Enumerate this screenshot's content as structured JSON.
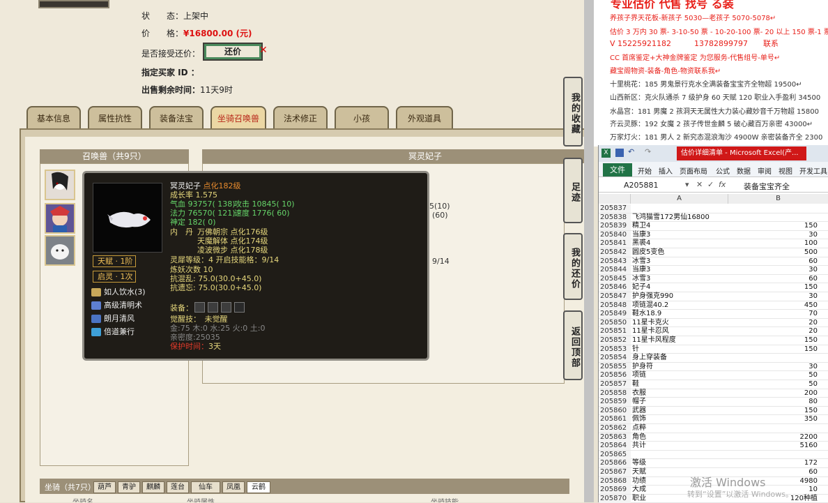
{
  "game": {
    "status_label": "状　　态：",
    "status_value": "上架中",
    "price_label": "价　　格：",
    "price_value": "¥16800.00 (元)",
    "accept_haggle_label": "是否接受还价：",
    "haggle_button": "还价",
    "buyer_id_label": "指定买家 ID ：",
    "remaining_label": "出售剩余时间：",
    "remaining_value": "11天9时",
    "tabs": [
      "基本信息",
      "属性抗性",
      "装备法宝",
      "坐骑召唤兽",
      "法术修正",
      "小孩",
      "外观道具"
    ],
    "active_tab": "坐骑召唤兽",
    "pet_list_title": "召唤兽（共9只）",
    "selected_pet_title": "冥灵妃子",
    "behind_text_1": "5(10)",
    "behind_text_2": "(60)",
    "behind_text_3": "9/14",
    "side_buttons": [
      "我的收藏",
      "足迹",
      "我的还价",
      "返回顶部"
    ],
    "mount_bar_label": "坐骑（共7只）",
    "mount_tabs": [
      "葫芦",
      "青驴",
      "麒麟",
      "莲台",
      "仙车",
      "凤凰",
      "云鹤"
    ],
    "mount_col_1": "坐骑名",
    "mount_col_2": "坐骑属性",
    "mount_col_3": "坐骑技能"
  },
  "tooltip": {
    "name": "冥灵妃子",
    "level": "点化182级",
    "growth": "成长率 1.575",
    "hp": "气血 93757( 138)",
    "attack": "攻击 10845( 10)",
    "mana": "法力 76570( 121)",
    "speed": "速度 1776( 60)",
    "spirit": "神定 182( 0)",
    "dan_label": "内　丹",
    "dan_1": "万佛朝宗 点化176级",
    "dan_2": "天魔解体 点化174级",
    "dan_3": "凌波微步 点化178级",
    "soul_level": "灵犀等级：4 开启技能格：9/14",
    "refine": "炼妖次数 10",
    "resist_chaos": "抗混乱: 75.0(30.0+45.0)",
    "resist_forget": "抗遗忘: 75.0(30.0+45.0)",
    "talent": "天赋 · 1阶",
    "enlighten": "启灵 · 1次",
    "skills": [
      "如人饮水(3)",
      "高级清明术",
      "朗月清风",
      "倍道兼行"
    ],
    "equip_label": "装备：",
    "awaken": "觉醒技：　未觉醒",
    "elements": "金:75 木:0 水:25 火:0 土:0",
    "intimacy": "亲密度:25035",
    "protect_label": "保护时间：",
    "protect_value": "3天"
  },
  "doc": {
    "headline": "专业估价 代售 找号 る装",
    "lines": [
      "养孩子界天花板-新孩子 5030—老孩子 5070-5078↵",
      "估价 3 万内 30 票- 3-10-50 票 - 10-20-100 票- 20 以上 150 票-1 票 1",
      "V 15225921182　　　13782899797　　联系",
      "CC 首席鉴定+大神金牌鉴定 为您服务-代售组号-单号↵",
      "藏宝阁物资-装备-角色-物资联系我↵",
      "十里桃花：185 男鬼景行克水全满装备宝宝齐全物超 19500↵",
      "山西新区：克火队通杀 7 级护身 60 天赋 120 职业入手盈利 34500",
      "水晶宫：181 男魔 2 孩洞天无属性大力装心藏妙音千万物超 15800",
      "齐云灵豚：192 女魔 2 孩子传世金麟 5 破心藏百万亲密 43000↵",
      "万家灯火：181 男人 2 新究态混浪淘沙 4900W 亲密装备齐全 2300"
    ]
  },
  "excel": {
    "title": "估价详细清单 - Microsoft Excel(产...",
    "menu": [
      "开始",
      "插入",
      "页面布局",
      "公式",
      "数据",
      "审阅",
      "视图",
      "开发工具"
    ],
    "file_tab": "文件",
    "cell_ref": "A205881",
    "formula": "装备宝宝齐全",
    "col_a": "A",
    "col_b": "B",
    "rows": [
      {
        "n": "205837",
        "a": "",
        "b": ""
      },
      {
        "n": "205838",
        "a": "飞鸿猫雪172男仙16800",
        "b": ""
      },
      {
        "n": "205839",
        "a": "精卫4",
        "b": "150"
      },
      {
        "n": "205840",
        "a": "当康3",
        "b": "30"
      },
      {
        "n": "205841",
        "a": "黑裘4",
        "b": "100"
      },
      {
        "n": "205842",
        "a": "圆皮5变色",
        "b": "500"
      },
      {
        "n": "205843",
        "a": "冰雪3",
        "b": "60"
      },
      {
        "n": "205844",
        "a": "当康3",
        "b": "30"
      },
      {
        "n": "205845",
        "a": "冰雪3",
        "b": "60"
      },
      {
        "n": "205846",
        "a": "妃子4",
        "b": "150"
      },
      {
        "n": "205847",
        "a": "护身强克990",
        "b": "30"
      },
      {
        "n": "205848",
        "a": "项链混40.2",
        "b": "450"
      },
      {
        "n": "205849",
        "a": "鞋水18.9",
        "b": "70"
      },
      {
        "n": "205850",
        "a": "11星卡克火",
        "b": "20"
      },
      {
        "n": "205851",
        "a": "11星卡忍风",
        "b": "20"
      },
      {
        "n": "205852",
        "a": "11星卡风程度",
        "b": "150"
      },
      {
        "n": "205853",
        "a": "针",
        "b": "150"
      },
      {
        "n": "205854",
        "a": "身上穿装备",
        "b": ""
      },
      {
        "n": "205855",
        "a": "护身符",
        "b": "30"
      },
      {
        "n": "205856",
        "a": "项链",
        "b": "50"
      },
      {
        "n": "205857",
        "a": "鞋",
        "b": "50"
      },
      {
        "n": "205858",
        "a": "衣服",
        "b": "200"
      },
      {
        "n": "205859",
        "a": "帽子",
        "b": "80"
      },
      {
        "n": "205860",
        "a": "武器",
        "b": "150"
      },
      {
        "n": "205861",
        "a": "佩饰",
        "b": "350"
      },
      {
        "n": "205862",
        "a": "点粹",
        "b": ""
      },
      {
        "n": "205863",
        "a": "角色",
        "b": "2200"
      },
      {
        "n": "205864",
        "a": "共计",
        "b": "5160"
      },
      {
        "n": "205865",
        "a": "",
        "b": ""
      },
      {
        "n": "205866",
        "a": "等级",
        "b": "172"
      },
      {
        "n": "205867",
        "a": "天赋",
        "b": "60"
      },
      {
        "n": "205868",
        "a": "功绩",
        "b": "4980"
      },
      {
        "n": "205869",
        "a": "大成",
        "b": "10"
      },
      {
        "n": "205870",
        "a": "职业",
        "b": "120种植"
      }
    ],
    "watermark": "激活 Windows",
    "watermark_sub": "转到“设置”以激活 Windows。"
  },
  "colors": {
    "price_red": "#d11111",
    "excel_green": "#217346",
    "tooltip_bg": "#1f1c17",
    "tab_active": "#b8281a"
  }
}
